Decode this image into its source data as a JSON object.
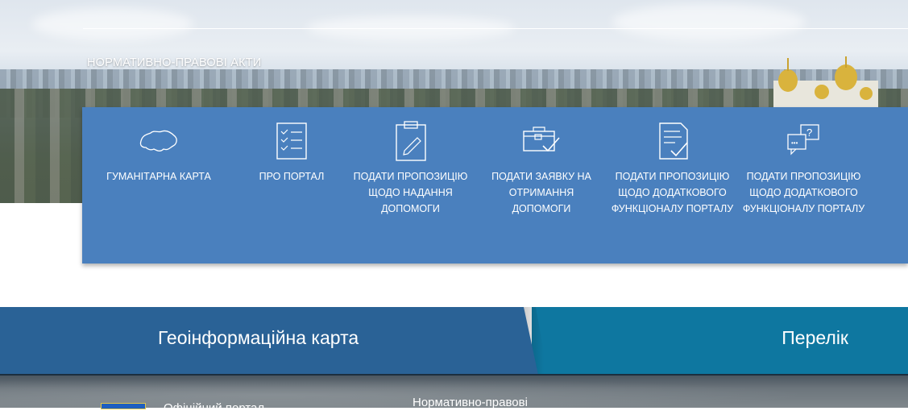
{
  "hero": {
    "title": "НОРМАТИВНО-ПРАВОВІ АКТИ"
  },
  "menu": {
    "items": [
      {
        "label": "ГУМАНІТАРНА КАРТА",
        "icon": "ukraine-map-icon"
      },
      {
        "label": "ПРО ПОРТАЛ",
        "icon": "checklist-icon"
      },
      {
        "label": "ПОДАТИ ПРОПОЗИЦІЮ ЩОДО НАДАННЯ ДОПОМОГИ",
        "icon": "clipboard-pen-icon"
      },
      {
        "label": "ПОДАТИ ЗАЯВКУ НА ОТРИМАННЯ ДОПОМОГИ",
        "icon": "briefcase-check-icon"
      },
      {
        "label": "ПОДАТИ ПРОПОЗИЦІЮ ЩОДО ДОДАТКОВОГО ФУНКЦІОНАЛУ ПОРТАЛУ",
        "icon": "document-check-icon"
      },
      {
        "label": "ПОДАТИ ПРОПОЗИЦІЮ ЩОДО ДОДАТКОВОГО ФУНКЦІОНАЛУ ПОРТАЛУ",
        "icon": "chat-question-icon"
      }
    ]
  },
  "tabs": {
    "geo": "Геоінформаційна карта",
    "list": "Перелік"
  },
  "footer": {
    "org": "Офіційний портал",
    "link": "Нормативно-правові"
  },
  "colors": {
    "menu_bg": "#4a80be",
    "tab_geo": "#2a6296",
    "tab_list": "#0e77a0"
  }
}
